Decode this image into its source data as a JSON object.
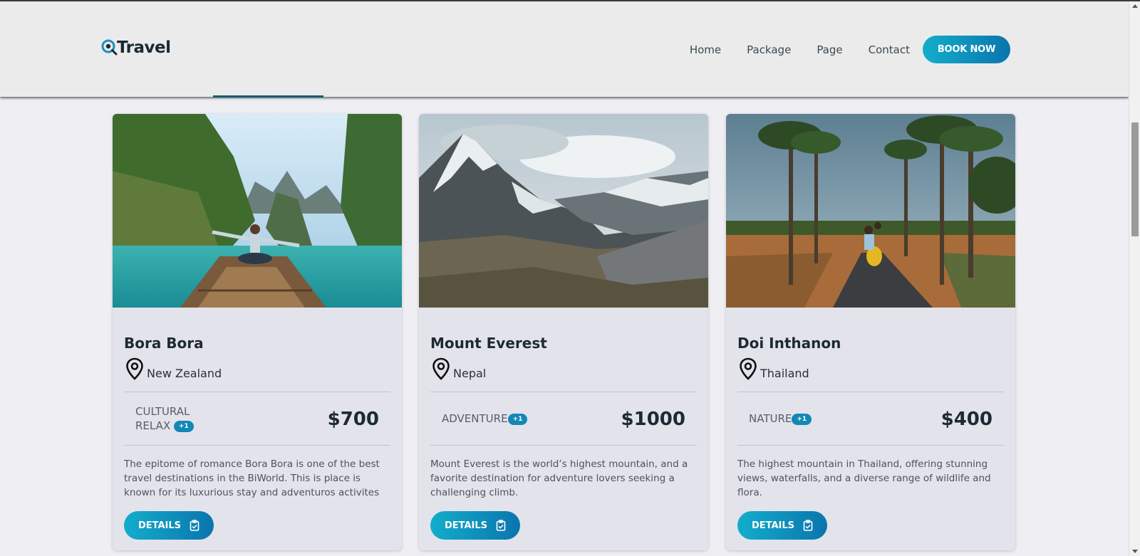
{
  "brand": {
    "name": "Travel"
  },
  "nav": {
    "items": [
      "Home",
      "Package",
      "Page",
      "Contact"
    ],
    "cta_label": "BOOK NOW"
  },
  "cards": [
    {
      "title": "Bora Bora",
      "location": "New Zealand",
      "tags": "CULTURAL RELAX",
      "badge": "+1",
      "price": "$700",
      "description": "The epitome of romance Bora Bora is one of the best travel destinations in the BiWorld. This is place is known for its luxurious stay and adventuros activites",
      "button_label": "DETAILS",
      "image": "lake-boat-photo"
    },
    {
      "title": "Mount Everest",
      "location": "Nepal",
      "tags": "ADVENTURE",
      "badge": "+1",
      "price": "$1000",
      "description": "Mount Everest is the world’s highest mountain, and a favorite destination for adventure lovers seeking a challenging climb.",
      "button_label": "DETAILS",
      "image": "snowy-mountain-photo"
    },
    {
      "title": "Doi Inthanon",
      "location": "Thailand",
      "tags": "NATURE",
      "badge": "+1",
      "price": "$400",
      "description": "The highest mountain in Thailand, offering stunning views, waterfalls, and a diverse range of wildlife and flora.",
      "button_label": "DETAILS",
      "image": "palm-road-scooter-photo"
    }
  ],
  "colors": {
    "accent_start": "#13adcc",
    "accent_end": "#0a75ad",
    "heading": "#1e2a33",
    "card_bg": "#e3e3ec",
    "header_bg": "#ebebeb"
  }
}
